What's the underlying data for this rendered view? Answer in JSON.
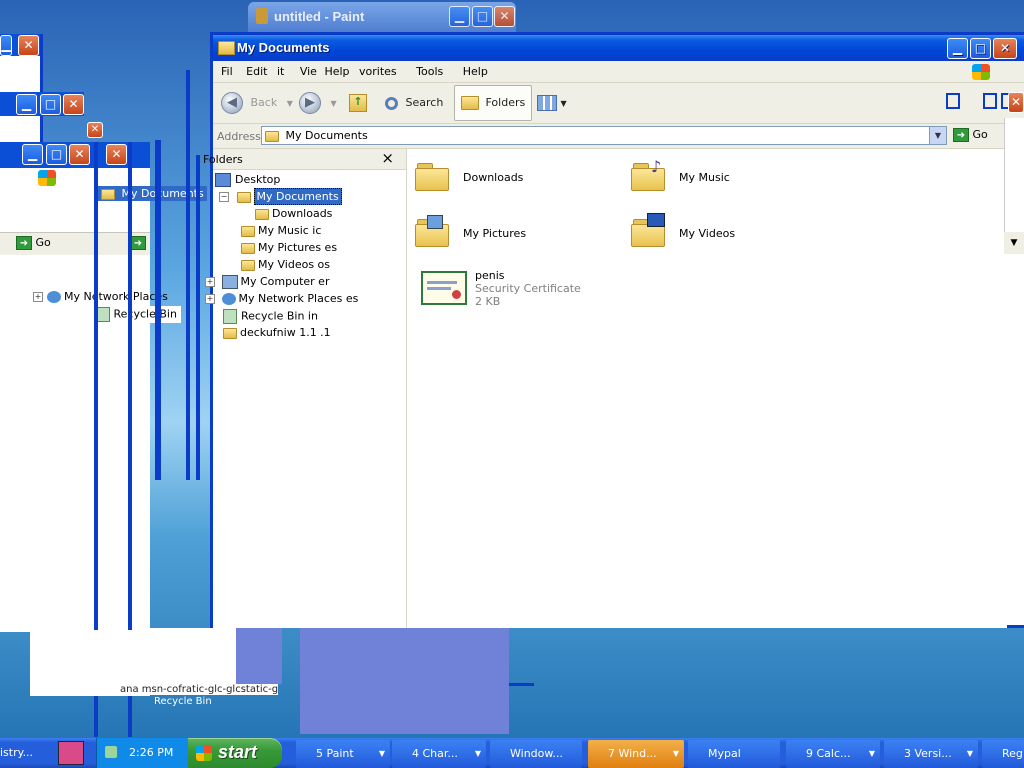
{
  "paint_window": {
    "title": "untitled - Paint"
  },
  "main_window": {
    "title": "My Documents",
    "menu": {
      "file": "Fil",
      "edit": "Edit",
      "it": "it",
      "view": "Vie",
      "help1": "Help",
      "favorites": "vorites",
      "tools": "Tools",
      "help2": "Help"
    },
    "toolbar": {
      "back": "Back",
      "search": "Search",
      "folders": "Folders"
    },
    "address": {
      "label": "Address",
      "value": "My Documents",
      "go": "Go"
    },
    "folders_pane": {
      "title": "Folders",
      "close": "×",
      "items": [
        "Desktop",
        "My Documents",
        "Downloads",
        "My Music ic",
        "My Pictures es",
        "My Videos os",
        "My Computer er",
        "My Network Places es",
        "Recycle Bin in",
        "deckufniw 1.1 .1"
      ]
    },
    "files": [
      {
        "name": "Downloads"
      },
      {
        "name": "My Music"
      },
      {
        "name": "My Pictures"
      },
      {
        "name": "My Videos"
      },
      {
        "name": "penis",
        "type": "Security Certificate",
        "size": "2 KB"
      }
    ]
  },
  "ghost": {
    "my_documents": "My Documents",
    "go": "Go",
    "network": "My Network Places",
    "recycle": "Recycle Bin",
    "bottom_text": "ana   msn-cofratic-glc-glcstatic-g",
    "bottom_recycle": "Recycle Bin"
  },
  "taskbar": {
    "left_text": "istry...",
    "clock": "2:26 PM",
    "start": "start",
    "items": [
      {
        "label": "5 Paint"
      },
      {
        "label": "4 Char..."
      },
      {
        "label": "Window..."
      },
      {
        "label": "7 Wind..."
      },
      {
        "label": "Mypal"
      },
      {
        "label": "9 Calc..."
      },
      {
        "label": "3 Versi..."
      },
      {
        "label": "Reg"
      }
    ]
  },
  "colors": {
    "title_blue": "#0a3cc8",
    "taskbar_blue": "#225ada",
    "start_green": "#3a9a3a",
    "active_task": "#e07f10"
  }
}
